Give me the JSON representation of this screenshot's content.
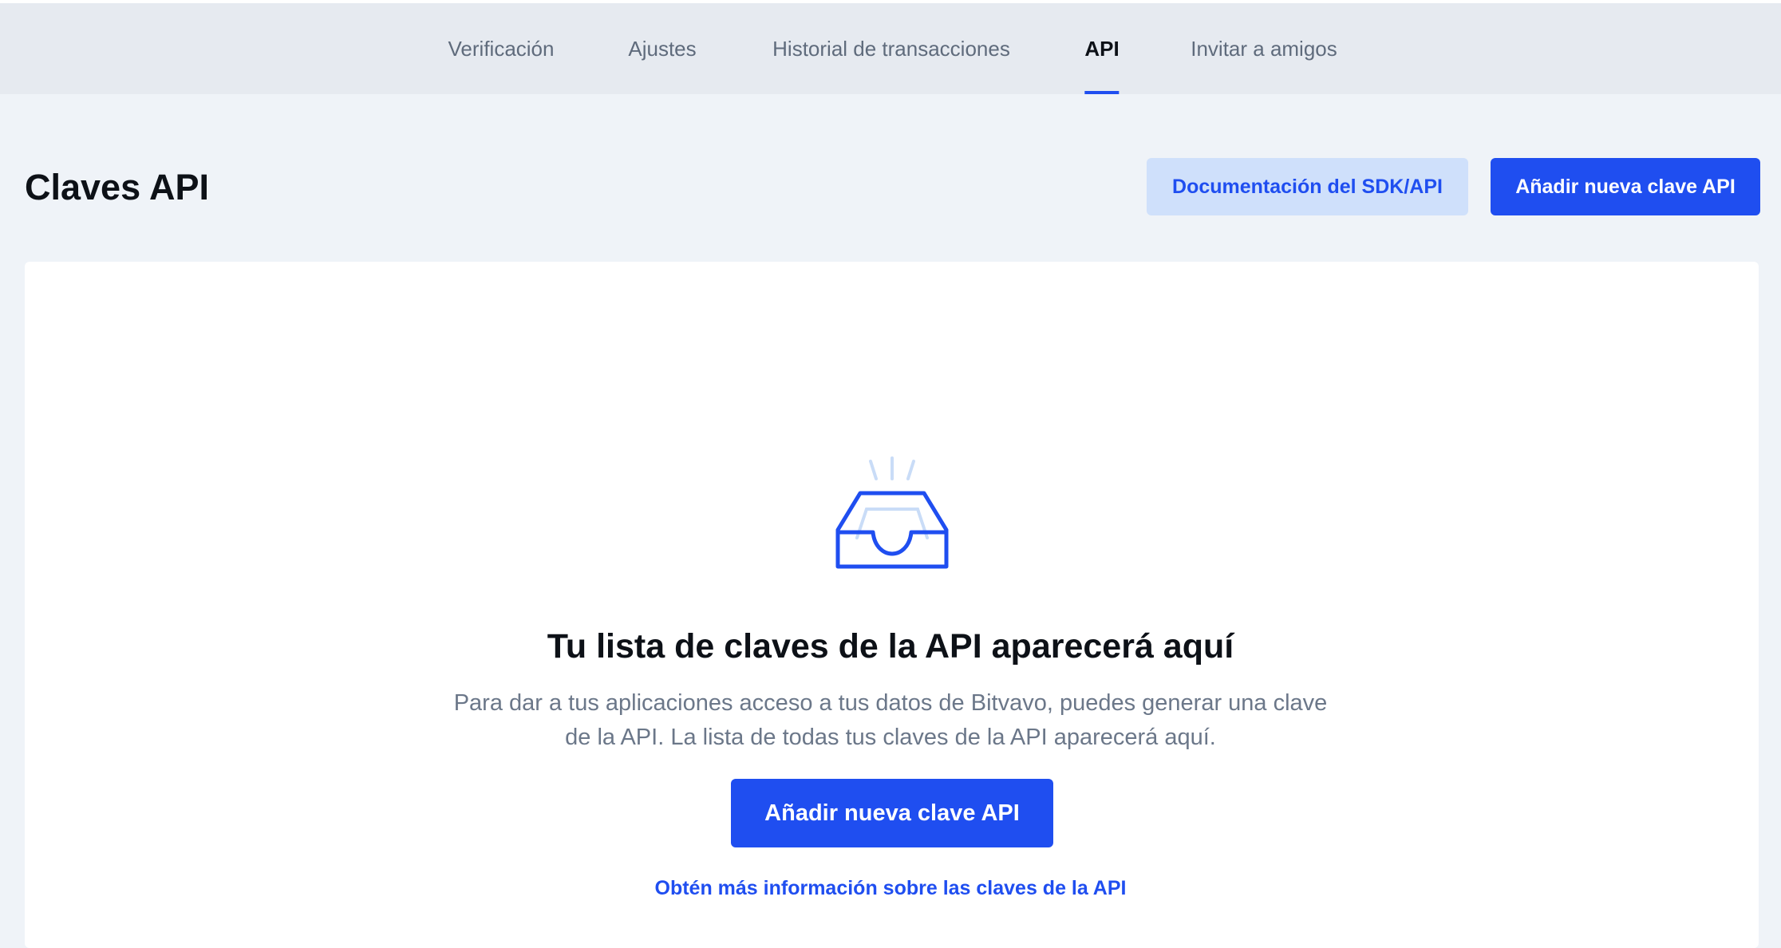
{
  "nav": {
    "tabs": [
      {
        "label": "Verificación"
      },
      {
        "label": "Ajustes"
      },
      {
        "label": "Historial de transacciones"
      },
      {
        "label": "API",
        "active": true
      },
      {
        "label": "Invitar a amigos"
      }
    ]
  },
  "header": {
    "title": "Claves API",
    "docs_button": "Documentación del SDK/API",
    "add_button": "Añadir nueva clave API"
  },
  "empty_state": {
    "icon": "inbox-tray-icon",
    "title": "Tu lista de claves de la API aparecerá aquí",
    "description": "Para dar a tus aplicaciones acceso a tus datos de Bitvavo, puedes generar una clave de la API. La lista de todas tus claves de la API aparecerá aquí.",
    "add_button": "Añadir nueva clave API",
    "learn_more": "Obtén más información sobre las claves de la API"
  },
  "colors": {
    "accent": "#1f4ef0",
    "accent_light": "#cfe0fb",
    "background": "#eff3f8",
    "topbar": "#e6eaf0",
    "text_dark": "#0d1117",
    "text_muted": "#6b7789"
  }
}
